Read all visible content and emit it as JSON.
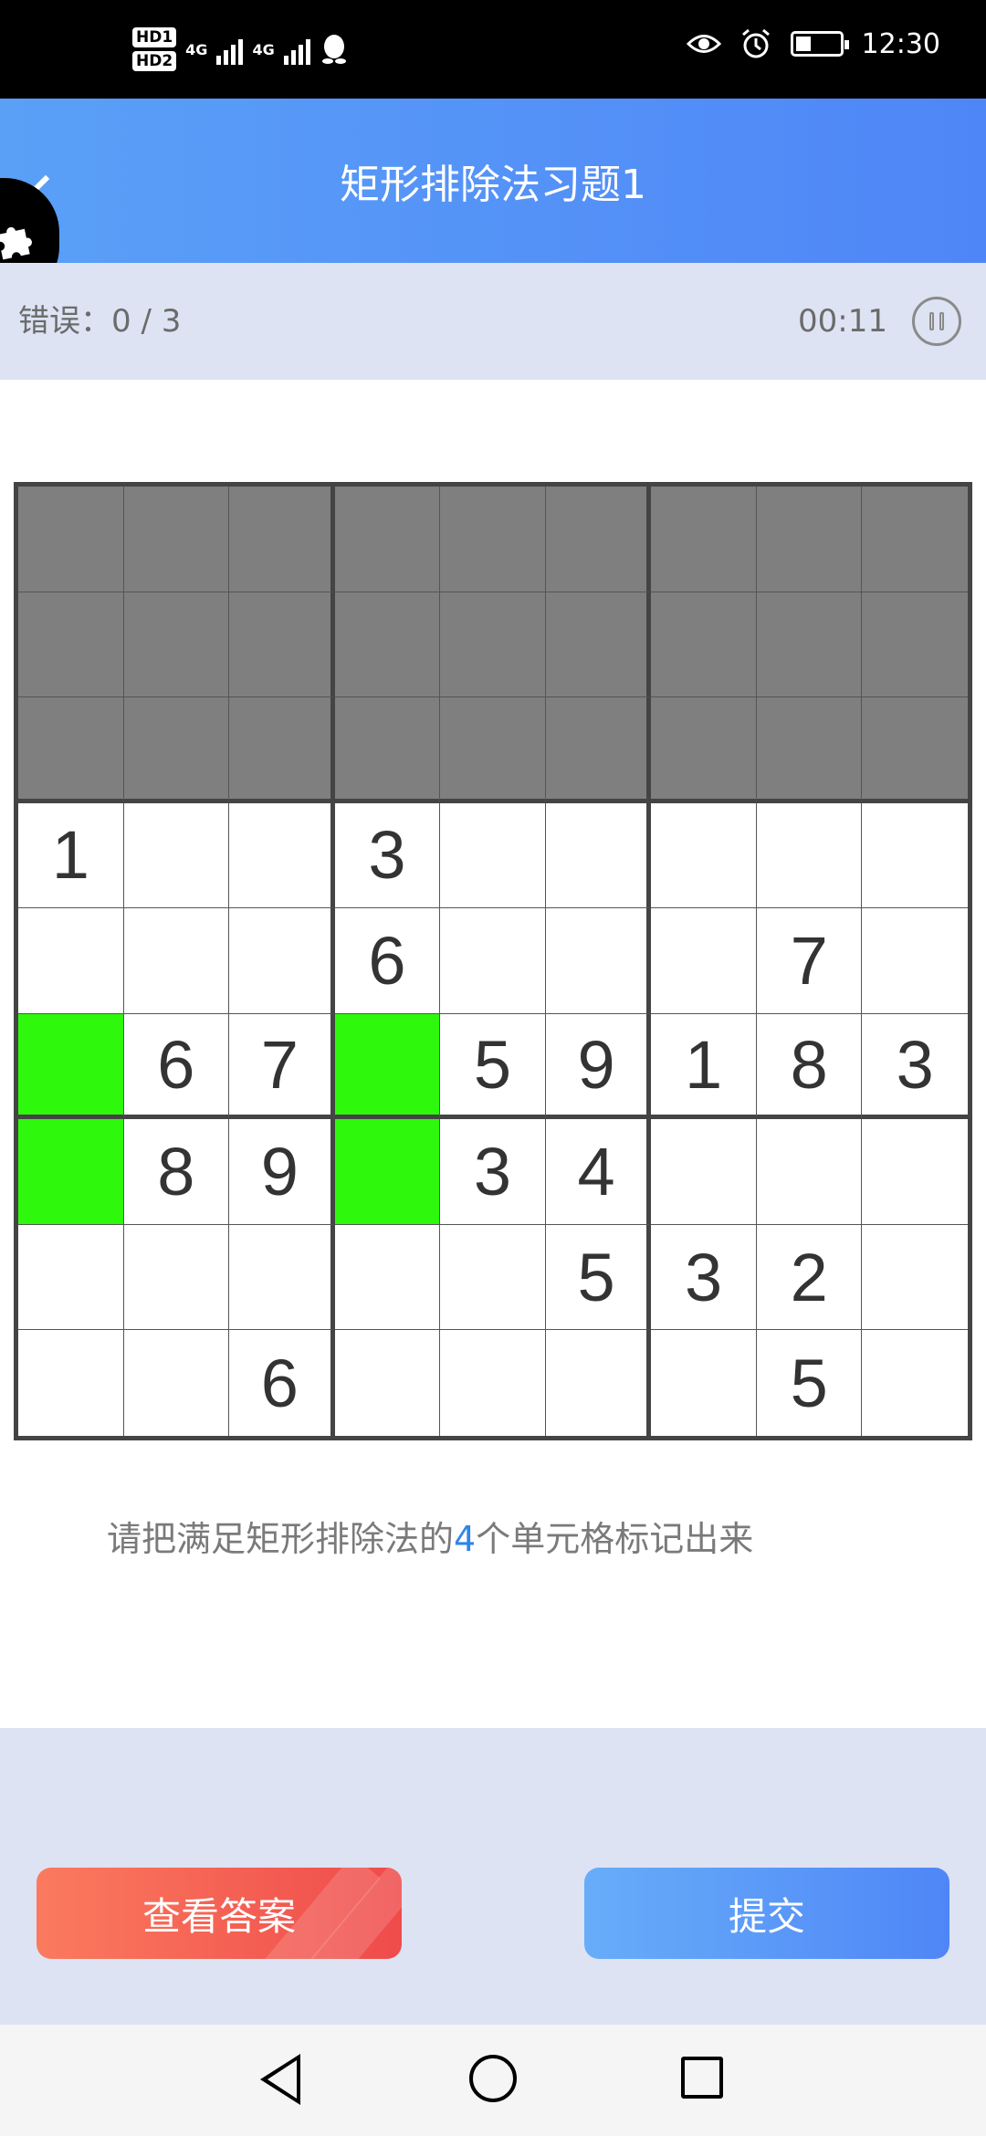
{
  "status_bar": {
    "hd1": "HD1",
    "hd2": "HD2",
    "net1": "4G",
    "net2": "4G",
    "time": "12:30"
  },
  "header": {
    "title": "矩形排除法习题1"
  },
  "info": {
    "errors": "错误：0 / 3",
    "timer": "00:11"
  },
  "board": {
    "rows": [
      [
        "",
        "",
        "",
        "",
        "",
        "",
        "",
        "",
        ""
      ],
      [
        "",
        "",
        "",
        "",
        "",
        "",
        "",
        "",
        ""
      ],
      [
        "",
        "",
        "",
        "",
        "",
        "",
        "",
        "",
        ""
      ],
      [
        "1",
        "",
        "",
        "3",
        "",
        "",
        "",
        "",
        ""
      ],
      [
        "",
        "",
        "",
        "6",
        "",
        "",
        "",
        "7",
        ""
      ],
      [
        "",
        "6",
        "7",
        "",
        "5",
        "9",
        "1",
        "8",
        "3"
      ],
      [
        "",
        "8",
        "9",
        "",
        "3",
        "4",
        "",
        "",
        ""
      ],
      [
        "",
        "",
        "",
        "",
        "",
        "5",
        "3",
        "2",
        ""
      ],
      [
        "",
        "",
        "6",
        "",
        "",
        "",
        "",
        "5",
        ""
      ]
    ],
    "shaded_rows": [
      1,
      2,
      3
    ],
    "highlighted_cells": [
      [
        6,
        1
      ],
      [
        6,
        4
      ],
      [
        7,
        1
      ],
      [
        7,
        4
      ]
    ],
    "colors": {
      "shaded": "#7f7f7f",
      "highlight": "#2ef80c"
    }
  },
  "instruction": {
    "before": "请把满足矩形排除法的",
    "count": "4",
    "after": "个单元格标记出来"
  },
  "buttons": {
    "view_answer": "查看答案",
    "submit": "提交"
  }
}
